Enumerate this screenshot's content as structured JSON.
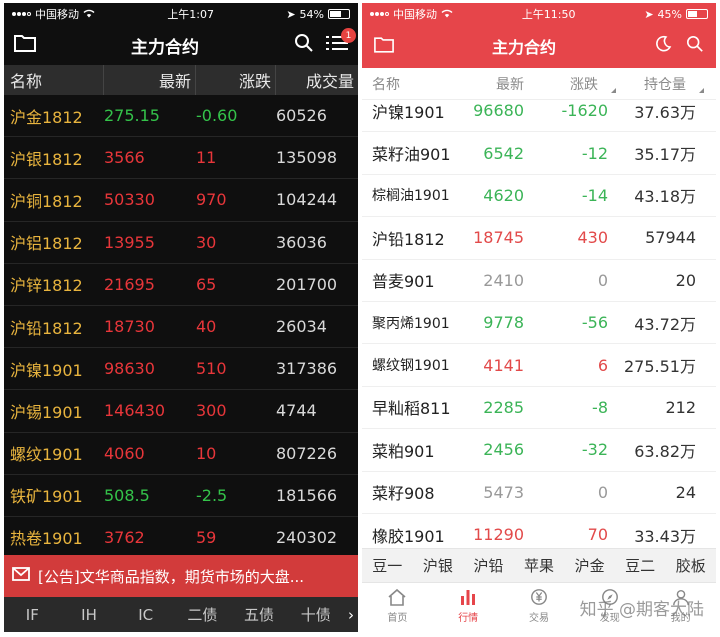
{
  "left": {
    "status": {
      "carrier": "中国移动",
      "time": "上午1:07",
      "battery": "54%"
    },
    "nav": {
      "title": "主力合约",
      "badge": "1"
    },
    "headers": [
      "名称",
      "最新",
      "涨跌",
      "成交量"
    ],
    "rows": [
      {
        "name": "沪金1812",
        "last": "275.15",
        "change": "-0.60",
        "volume": "60526",
        "dir": "dn"
      },
      {
        "name": "沪银1812",
        "last": "3566",
        "change": "11",
        "volume": "135098",
        "dir": "up"
      },
      {
        "name": "沪铜1812",
        "last": "50330",
        "change": "970",
        "volume": "104244",
        "dir": "up"
      },
      {
        "name": "沪铝1812",
        "last": "13955",
        "change": "30",
        "volume": "36036",
        "dir": "up"
      },
      {
        "name": "沪锌1812",
        "last": "21695",
        "change": "65",
        "volume": "201700",
        "dir": "up"
      },
      {
        "name": "沪铅1812",
        "last": "18730",
        "change": "40",
        "volume": "26034",
        "dir": "up"
      },
      {
        "name": "沪镍1901",
        "last": "98630",
        "change": "510",
        "volume": "317386",
        "dir": "up"
      },
      {
        "name": "沪锡1901",
        "last": "146430",
        "change": "300",
        "volume": "4744",
        "dir": "up"
      },
      {
        "name": "螺纹1901",
        "last": "4060",
        "change": "10",
        "volume": "807226",
        "dir": "up"
      },
      {
        "name": "铁矿1901",
        "last": "508.5",
        "change": "-2.5",
        "volume": "181566",
        "dir": "dn"
      },
      {
        "name": "热卷1901",
        "last": "3762",
        "change": "59",
        "volume": "240302",
        "dir": "up"
      }
    ],
    "notice": "[公告]文华商品指数，期货市场的大盘...",
    "tabs": [
      "IF",
      "IH",
      "IC",
      "二债",
      "五债",
      "十债"
    ],
    "tabs_more": "›"
  },
  "right": {
    "status": {
      "carrier": "中国移动",
      "time": "上午11:50",
      "battery": "45%"
    },
    "nav": {
      "title": "主力合约"
    },
    "headers": [
      "名称",
      "最新",
      "涨跌",
      "持仓量"
    ],
    "rows": [
      {
        "name": "沪镍1901",
        "last": "96680",
        "change": "-1620",
        "oi": "37.63万",
        "dir": "dn"
      },
      {
        "name": "菜籽油901",
        "last": "6542",
        "change": "-12",
        "oi": "35.17万",
        "dir": "dn"
      },
      {
        "name": "棕榈油1901",
        "last": "4620",
        "change": "-14",
        "oi": "43.18万",
        "dir": "dn"
      },
      {
        "name": "沪铅1812",
        "last": "18745",
        "change": "430",
        "oi": "57944",
        "dir": "up"
      },
      {
        "name": "普麦901",
        "last": "2410",
        "change": "0",
        "oi": "20",
        "dir": "flat"
      },
      {
        "name": "聚丙烯1901",
        "last": "9778",
        "change": "-56",
        "oi": "43.72万",
        "dir": "dn"
      },
      {
        "name": "螺纹钢1901",
        "last": "4141",
        "change": "6",
        "oi": "275.51万",
        "dir": "up"
      },
      {
        "name": "早籼稻811",
        "last": "2285",
        "change": "-8",
        "oi": "212",
        "dir": "dn"
      },
      {
        "name": "菜粕901",
        "last": "2456",
        "change": "-32",
        "oi": "63.82万",
        "dir": "dn"
      },
      {
        "name": "菜籽908",
        "last": "5473",
        "change": "0",
        "oi": "24",
        "dir": "flat"
      },
      {
        "name": "橡胶1901",
        "last": "11290",
        "change": "70",
        "oi": "33.43万",
        "dir": "up"
      }
    ],
    "categories": [
      "豆一",
      "沪银",
      "沪铅",
      "苹果",
      "沪金",
      "豆二",
      "胶板"
    ],
    "tabbar": [
      {
        "label": "首页",
        "icon": "home-icon"
      },
      {
        "label": "行情",
        "icon": "market-chart-icon",
        "active": true
      },
      {
        "label": "交易",
        "icon": "yen-icon"
      },
      {
        "label": "发现",
        "icon": "discover-icon"
      },
      {
        "label": "我的",
        "icon": "profile-icon"
      }
    ],
    "watermark": "知乎 @期客大陆"
  },
  "colors": {
    "up": "#e8363a",
    "down": "#34c34a",
    "accent": "#e6454a",
    "name_gold": "#e8b43e"
  }
}
